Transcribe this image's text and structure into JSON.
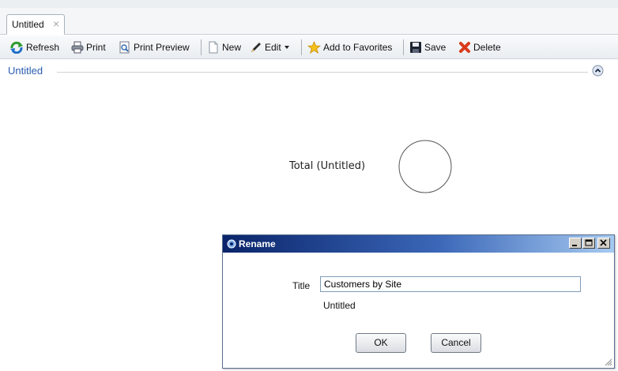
{
  "tab": {
    "label": "Untitled",
    "close_glyph": "×"
  },
  "toolbar": {
    "refresh": "Refresh",
    "print": "Print",
    "print_preview": "Print Preview",
    "new": "New",
    "edit": "Edit",
    "add_favorites": "Add to Favorites",
    "save": "Save",
    "delete": "Delete"
  },
  "section": {
    "title": "Untitled",
    "collapse_icon": "chevron-up-circle"
  },
  "chart": {
    "label": "Total (Untitled)"
  },
  "dialog": {
    "title": "Rename",
    "field_label": "Title",
    "title_value": "Customers by Site",
    "original_name": "Untitled",
    "ok": "OK",
    "cancel": "Cancel"
  },
  "colors": {
    "dialog_title_start": "#0a246a",
    "dialog_title_end": "#a6caf0",
    "section_title": "#2a5db0",
    "delete_icon": "#d93a1c"
  }
}
